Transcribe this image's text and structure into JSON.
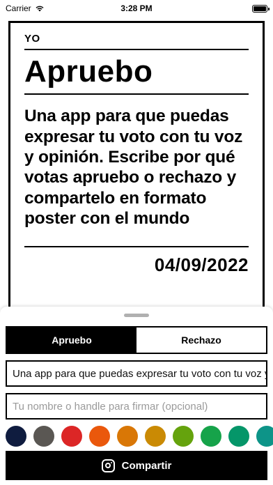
{
  "status_bar": {
    "carrier": "Carrier",
    "time": "3:28 PM",
    "battery_level": 1.0
  },
  "poster": {
    "small_label": "YO",
    "title": "Apruebo",
    "body": "Una app para que puedas expresar tu voto con tu voz y opinión. Escribe por qué votas apruebo o rechazo y compartelo en formato poster con el mundo",
    "date": "04/09/2022"
  },
  "sheet": {
    "segments": [
      {
        "label": "Apruebo",
        "selected": true
      },
      {
        "label": "Rechazo",
        "selected": false
      }
    ],
    "message_value": "Una app para que puedas expresar tu voto con tu voz y opinión. Escribe por qué votas apruebo o rechazo y compartelo en formato poster con el mundo",
    "name_placeholder": "Tu nombre o handle para firmar (opcional)",
    "colors": [
      "#0f1c3f",
      "#5a5753",
      "#dc2626",
      "#ea580c",
      "#d97706",
      "#ca8a04",
      "#65a30d",
      "#16a34a",
      "#059669",
      "#0d9488",
      "#0891b2"
    ],
    "share_label": "Compartir",
    "share_icon": "instagram-icon"
  }
}
